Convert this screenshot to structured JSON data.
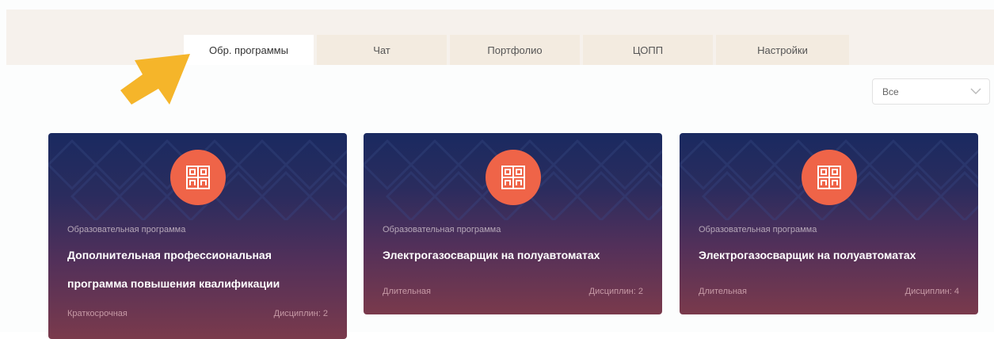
{
  "tabs": [
    {
      "label": "Обр. программы",
      "active": true
    },
    {
      "label": "Чат",
      "active": false
    },
    {
      "label": "Портфолио",
      "active": false
    },
    {
      "label": "ЦОПП",
      "active": false
    },
    {
      "label": "Настройки",
      "active": false
    }
  ],
  "filter": {
    "selected": "Все",
    "icon": "chevron-down-icon"
  },
  "pointer": {
    "icon": "arrow-pointer-icon",
    "color": "#f5b52a"
  },
  "colors": {
    "accent": "#ef6448",
    "card_top": "#1a2a60",
    "card_bottom": "#7a3a4c"
  },
  "cards": [
    {
      "kicker": "Образовательная программа",
      "title": "Дополнительная профессиональная программа повышения квалификации",
      "duration": "Краткосрочная",
      "disciplines": "Дисциплин: 2",
      "logo_icon": "copp-logo-icon"
    },
    {
      "kicker": "Образовательная программа",
      "title": "Электрогазосварщик на полуавтоматах",
      "duration": "Длительная",
      "disciplines": "Дисциплин: 2",
      "logo_icon": "copp-logo-icon"
    },
    {
      "kicker": "Образовательная программа",
      "title": "Электрогазосварщик на полуавтоматах",
      "duration": "Длительная",
      "disciplines": "Дисциплин: 4",
      "logo_icon": "copp-logo-icon"
    }
  ]
}
